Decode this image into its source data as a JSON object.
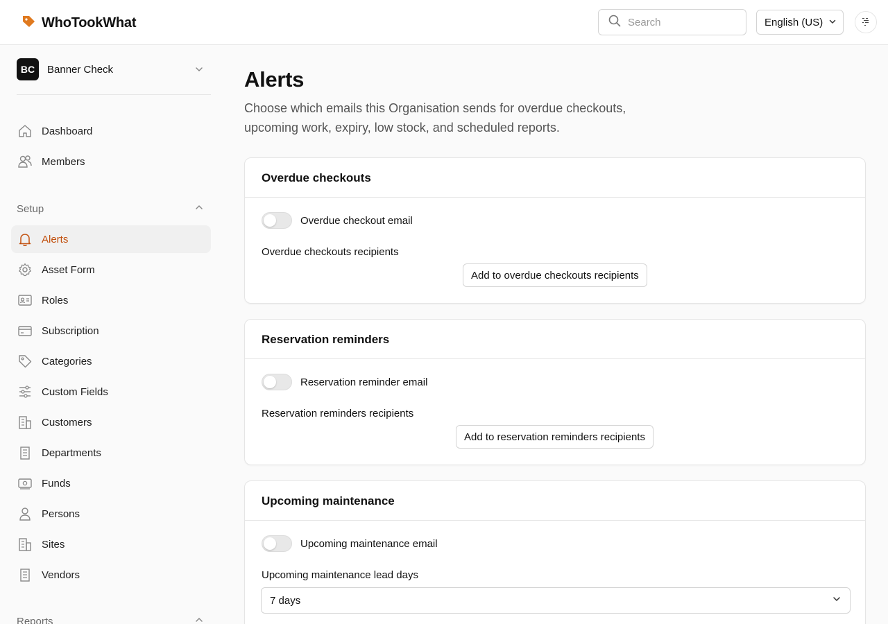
{
  "app": {
    "name": "WhoTookWhat"
  },
  "header": {
    "search_placeholder": "Search",
    "language": "English (US)"
  },
  "org": {
    "initials": "BC",
    "name": "Banner Check"
  },
  "sidebar": {
    "top_items": [
      {
        "label": "Dashboard",
        "icon": "home-icon"
      },
      {
        "label": "Members",
        "icon": "users-icon"
      }
    ],
    "setup_label": "Setup",
    "setup_items": [
      {
        "label": "Alerts",
        "icon": "bell-icon",
        "active": true
      },
      {
        "label": "Asset Form",
        "icon": "gear-icon"
      },
      {
        "label": "Roles",
        "icon": "id-card-icon"
      },
      {
        "label": "Subscription",
        "icon": "credit-card-icon"
      },
      {
        "label": "Categories",
        "icon": "tag-icon"
      },
      {
        "label": "Custom Fields",
        "icon": "sliders-icon"
      },
      {
        "label": "Customers",
        "icon": "building-icon"
      },
      {
        "label": "Departments",
        "icon": "building-icon"
      },
      {
        "label": "Funds",
        "icon": "banknote-icon"
      },
      {
        "label": "Persons",
        "icon": "person-icon"
      },
      {
        "label": "Sites",
        "icon": "building-icon"
      },
      {
        "label": "Vendors",
        "icon": "building-icon"
      }
    ],
    "reports_label": "Reports"
  },
  "page": {
    "title": "Alerts",
    "subtitle": "Choose which emails this Organisation sends for overdue checkouts, upcoming work, expiry, low stock, and scheduled reports."
  },
  "cards": [
    {
      "title": "Overdue checkouts",
      "toggle_label": "Overdue checkout email",
      "enabled": false,
      "field_label": "Overdue checkouts recipients",
      "button_label": "Add to overdue checkouts recipients"
    },
    {
      "title": "Reservation reminders",
      "toggle_label": "Reservation reminder email",
      "enabled": false,
      "field_label": "Reservation reminders recipients",
      "button_label": "Add to reservation reminders recipients"
    },
    {
      "title": "Upcoming maintenance",
      "toggle_label": "Upcoming maintenance email",
      "enabled": false,
      "field_label": "Upcoming maintenance lead days",
      "select_value": "7 days"
    }
  ],
  "colors": {
    "accent": "#c2500e",
    "logo": "#e07a1f"
  }
}
